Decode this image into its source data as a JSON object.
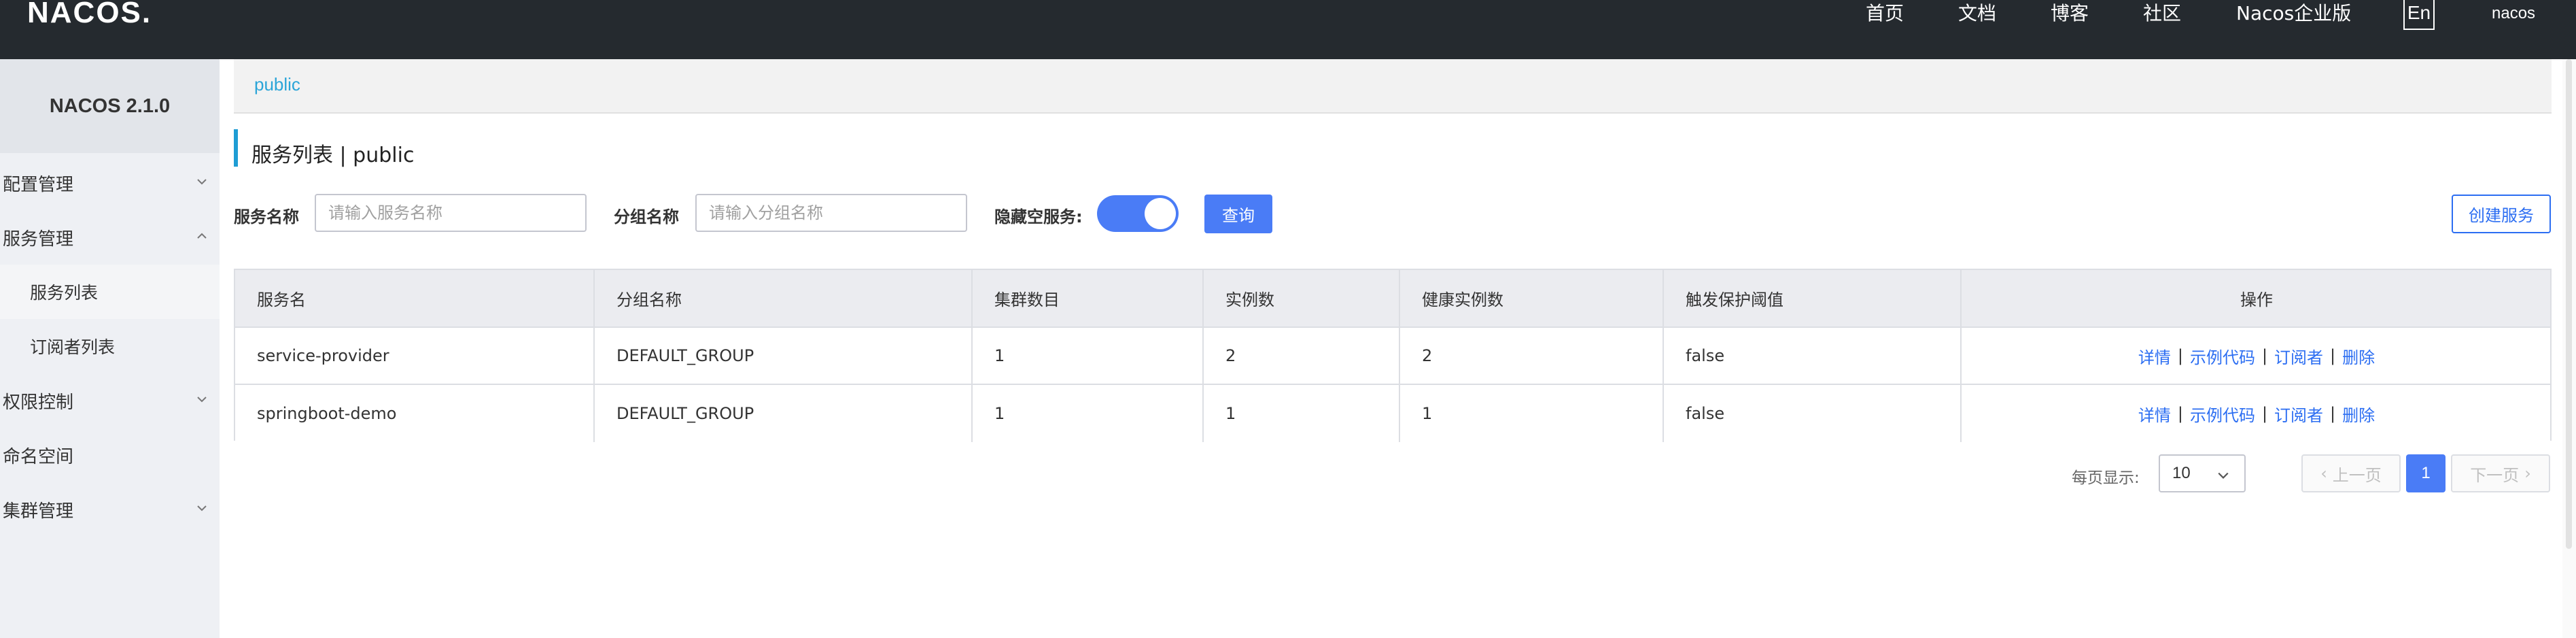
{
  "navbar": {
    "logo": "NACOS.",
    "links": [
      "首页",
      "文档",
      "博客",
      "社区",
      "Nacos企业版"
    ],
    "lang": "En",
    "user": "nacos"
  },
  "sidebar": {
    "version": "NACOS 2.1.0",
    "items": [
      {
        "label": "配置管理",
        "icon": "chevron-down-icon"
      },
      {
        "label": "服务管理",
        "icon": "chevron-up-icon"
      },
      {
        "label": "服务列表"
      },
      {
        "label": "订阅者列表"
      },
      {
        "label": "权限控制",
        "icon": "chevron-down-icon"
      },
      {
        "label": "命名空间"
      },
      {
        "label": "集群管理",
        "icon": "chevron-down-icon"
      }
    ]
  },
  "breadcrumb": "public",
  "page": {
    "title": "服务列表 | public"
  },
  "filters": {
    "service_name_label": "服务名称",
    "service_name_placeholder": "请输入服务名称",
    "group_name_label": "分组名称",
    "group_name_placeholder": "请输入分组名称",
    "hide_empty_label": "隐藏空服务:",
    "hide_empty_on": true,
    "query_button": "查询",
    "create_button": "创建服务"
  },
  "table": {
    "columns": [
      "服务名",
      "分组名称",
      "集群数目",
      "实例数",
      "健康实例数",
      "触发保护阈值",
      "操作"
    ],
    "rows": [
      [
        "service-provider",
        "DEFAULT_GROUP",
        "1",
        "2",
        "2",
        "false"
      ],
      [
        "springboot-demo",
        "DEFAULT_GROUP",
        "1",
        "1",
        "1",
        "false"
      ]
    ],
    "actions": [
      "详情",
      "示例代码",
      "订阅者",
      "删除"
    ]
  },
  "pagination": {
    "page_size_label": "每页显示:",
    "page_size": "10",
    "prev": "上一页",
    "next": "下一页",
    "current": "1"
  },
  "colors": {
    "navbar_bg": "#252a2f",
    "accent": "#4a7cf6",
    "link": "#2c6ef2",
    "breadcrumb": "#2ba5d8"
  }
}
